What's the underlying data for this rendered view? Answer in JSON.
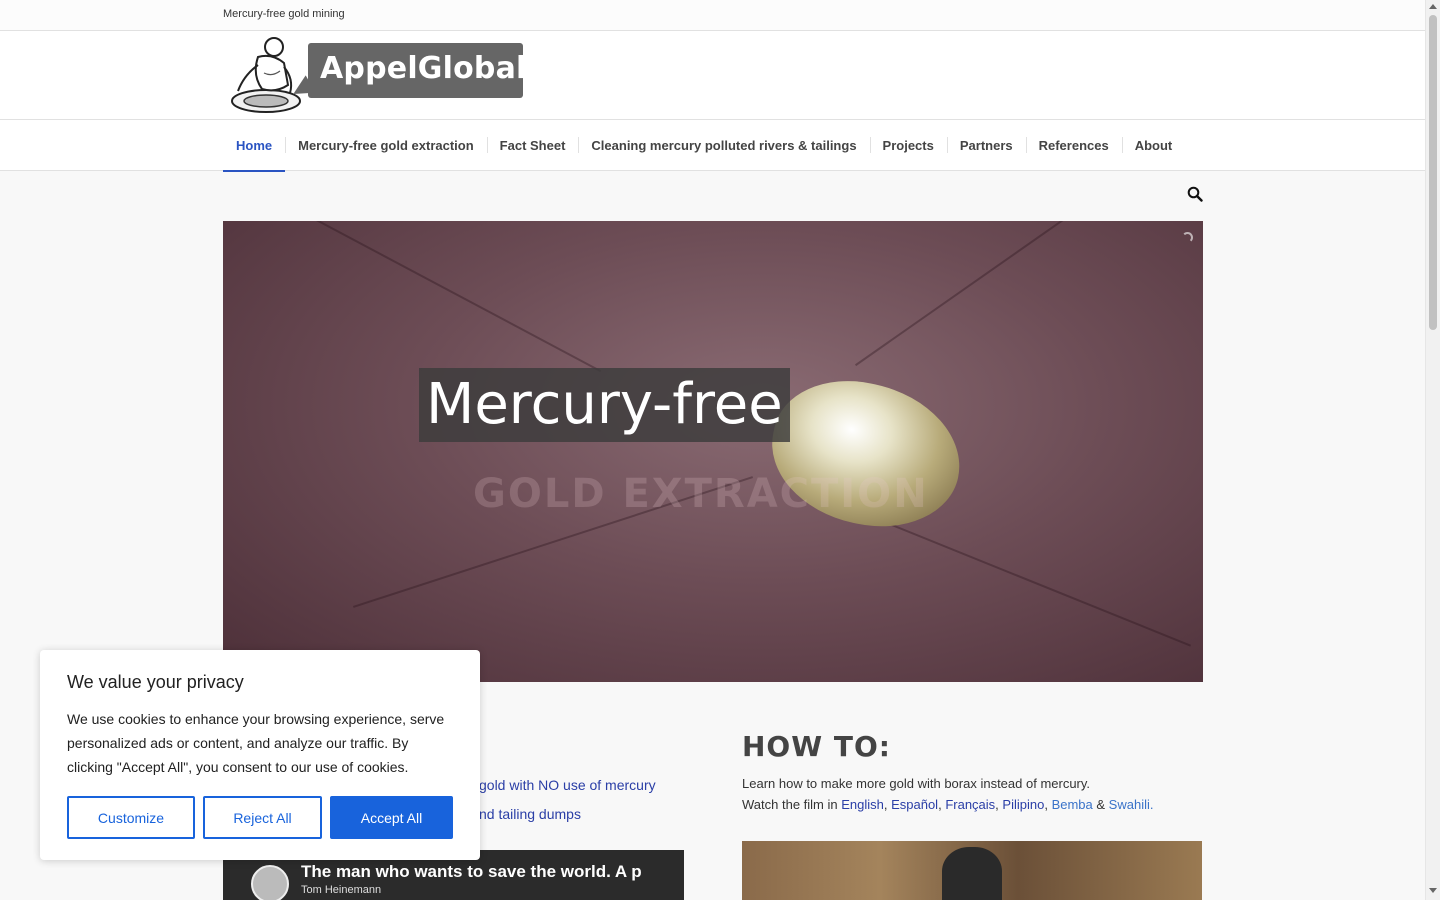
{
  "topbar": {
    "tagline": "Mercury-free gold mining"
  },
  "logo": {
    "text": "AppelGlobal"
  },
  "nav": {
    "items": [
      {
        "label": "Home",
        "active": true
      },
      {
        "label": "Mercury-free gold extraction",
        "active": false
      },
      {
        "label": "Fact Sheet",
        "active": false
      },
      {
        "label": "Cleaning mercury polluted rivers & tailings",
        "active": false
      },
      {
        "label": "Projects",
        "active": false
      },
      {
        "label": "Partners",
        "active": false
      },
      {
        "label": "References",
        "active": false
      },
      {
        "label": "About",
        "active": false
      }
    ]
  },
  "search": {
    "icon": "search-icon"
  },
  "hero": {
    "headline": "Mercury-free",
    "subline": "GOLD EXTRACTION"
  },
  "left": {
    "link1": "gold with NO use of mercury",
    "link2": "nd tailing dumps",
    "video": {
      "title": "The man who wants to save the world. A p",
      "author": "Tom Heinemann"
    }
  },
  "howto": {
    "heading": "HOW TO:",
    "line1": "Learn how to make more gold with borax instead of mercury.",
    "line2_prefix": "Watch the film in ",
    "languages": [
      "English",
      "Español",
      "Français",
      "Pilipino",
      "Bemba",
      "Swahili."
    ],
    "sep_comma": ", ",
    "sep_amp": " & "
  },
  "cookie": {
    "title": "We value your privacy",
    "message": "We use cookies to enhance your browsing experience, serve personalized ads or content, and analyze our traffic. By clicking \"Accept All\", you consent to our use of cookies.",
    "customize": "Customize",
    "reject": "Reject All",
    "accept": "Accept All"
  },
  "colors": {
    "accent": "#2a54c2",
    "cookie_button": "#1863dc",
    "logo_bubble": "#666666"
  }
}
